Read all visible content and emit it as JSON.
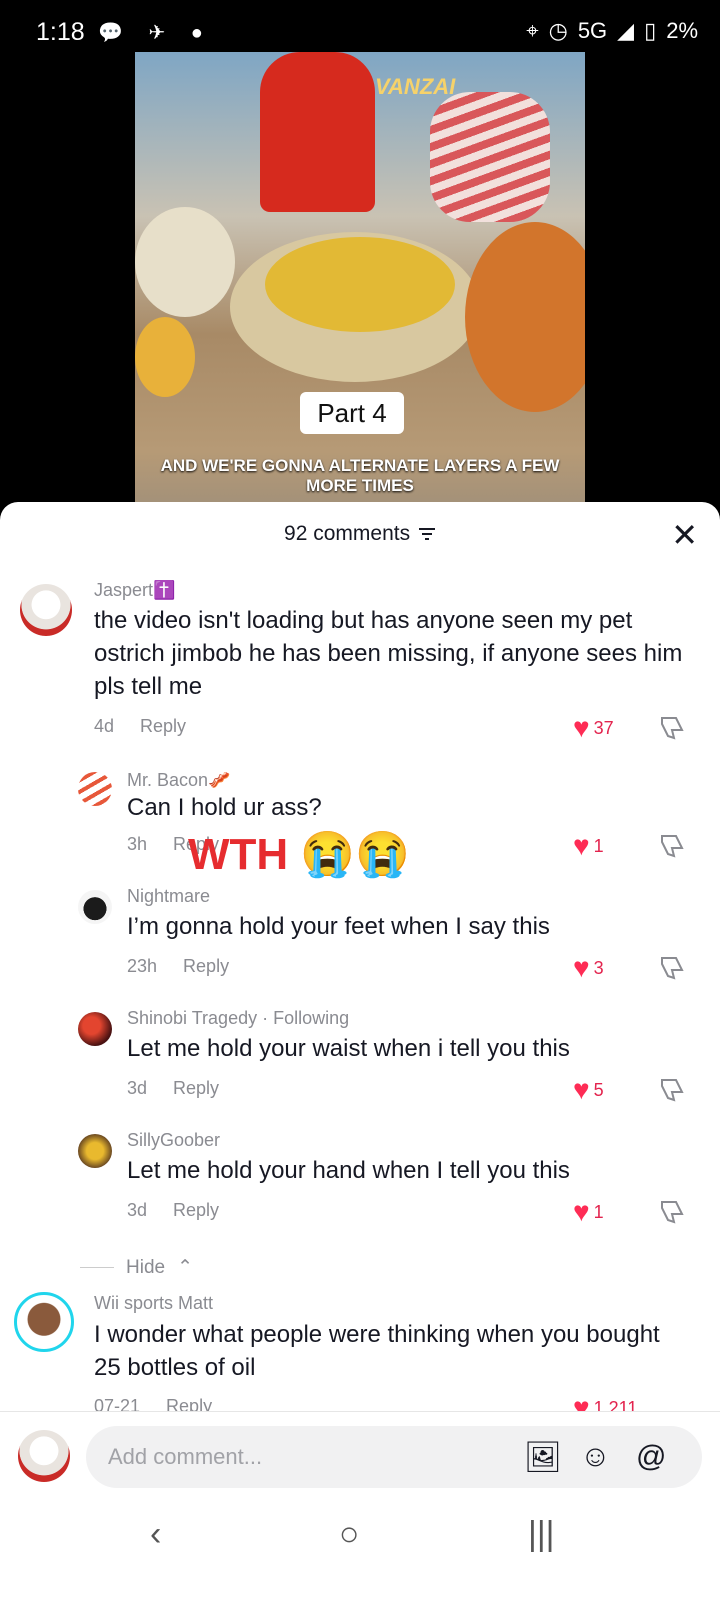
{
  "status": {
    "time": "1:18",
    "network": "5G",
    "battery": "2%"
  },
  "video": {
    "brand": "VANZAI",
    "part_label": "Part 4",
    "caption": "AND WE'RE GONNA ALTERNATE LAYERS A FEW MORE TIMES"
  },
  "sheet": {
    "count_label": "92 comments"
  },
  "comments": [
    {
      "name": "Jaspert✝️",
      "text": "the video isn't loading but has anyone seen my pet ostrich jimbob he has been missing, if anyone sees him pls tell me",
      "age": "4d",
      "reply": "Reply",
      "likes": "37"
    },
    {
      "name": "Mr. Bacon🥓",
      "text": "Can I hold ur ass?",
      "age": "3h",
      "reply": "Reply",
      "likes": "1"
    },
    {
      "name": "Nightmare",
      "text": "I’m gonna hold your feet when I say this",
      "age": "23h",
      "reply": "Reply",
      "likes": "3"
    },
    {
      "name": "Shinobi Tragedy · Following",
      "text": "Let me hold your waist when i tell you this",
      "age": "3d",
      "reply": "Reply",
      "likes": "5"
    },
    {
      "name": "SillyGoober",
      "text": "Let me hold your hand when I tell you this",
      "age": "3d",
      "reply": "Reply",
      "likes": "1"
    },
    {
      "name": "Wii sports Matt",
      "text": "I wonder what people were thinking when you bought 25 bottles of oil",
      "age": "07-21",
      "reply": "Reply",
      "likes": "1,211"
    }
  ],
  "hide_label": "Hide",
  "overlay_text": "WTH 😭😭",
  "input": {
    "placeholder": "Add comment..."
  }
}
